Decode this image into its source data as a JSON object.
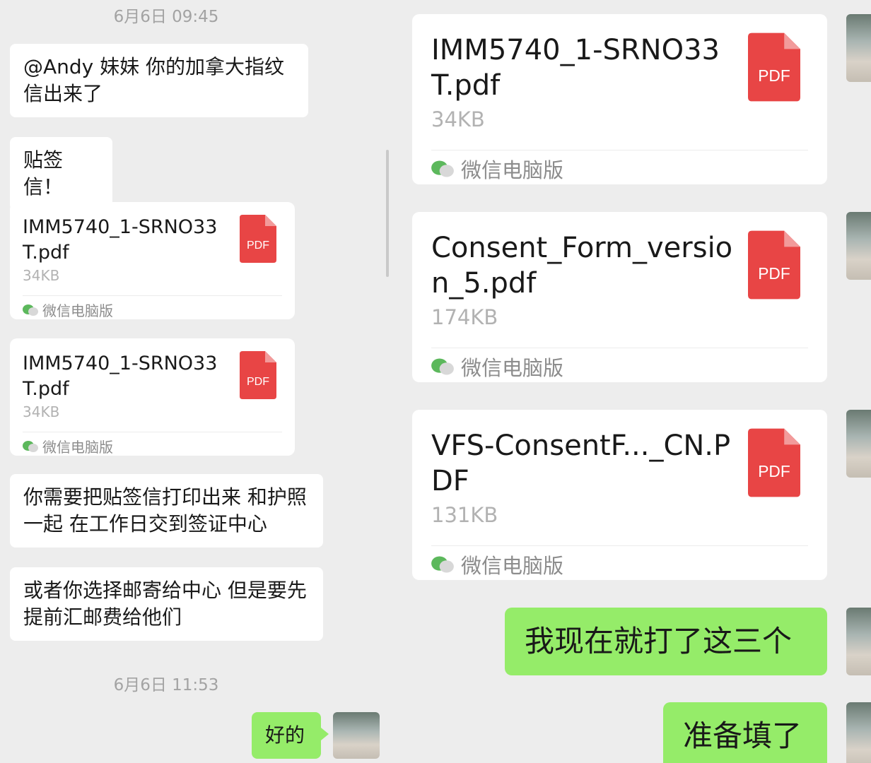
{
  "left": {
    "timestamp1": "6月6日 09:45",
    "msg1": "@Andy 妹妹 你的加拿大指纹信出来了",
    "msg2": "贴签信！",
    "file1": {
      "name": "IMM5740_1-SRNO33T.pdf",
      "size": "34KB",
      "source": "微信电脑版",
      "icon_label": "PDF"
    },
    "file2": {
      "name": "IMM5740_1-SRNO33T.pdf",
      "size": "34KB",
      "source": "微信电脑版",
      "icon_label": "PDF"
    },
    "msg3": "你需要把贴签信打印出来 和护照一起 在工作日交到签证中心",
    "msg4": "或者你选择邮寄给中心 但是要先提前汇邮费给他们",
    "timestamp2": "6月6日 11:53",
    "reply": "好的"
  },
  "right": {
    "file1": {
      "name": "IMM5740_1-SRNO33T.pdf",
      "size": "34KB",
      "source": "微信电脑版",
      "icon_label": "PDF"
    },
    "file2": {
      "name": "Consent_Form_version_5.pdf",
      "size": "174KB",
      "source": "微信电脑版",
      "icon_label": "PDF"
    },
    "file3": {
      "name": "VFS-ConsentF..._CN.PDF",
      "size": "131KB",
      "source": "微信电脑版",
      "icon_label": "PDF"
    },
    "msg1": "我现在就打了这三个",
    "msg2": "准备填了"
  },
  "colors": {
    "own_bubble": "#95ec69",
    "pdf_red": "#e84545",
    "background": "#ededed"
  },
  "icons": {
    "pdf": "pdf-file-icon",
    "wechat": "wechat-icon"
  }
}
